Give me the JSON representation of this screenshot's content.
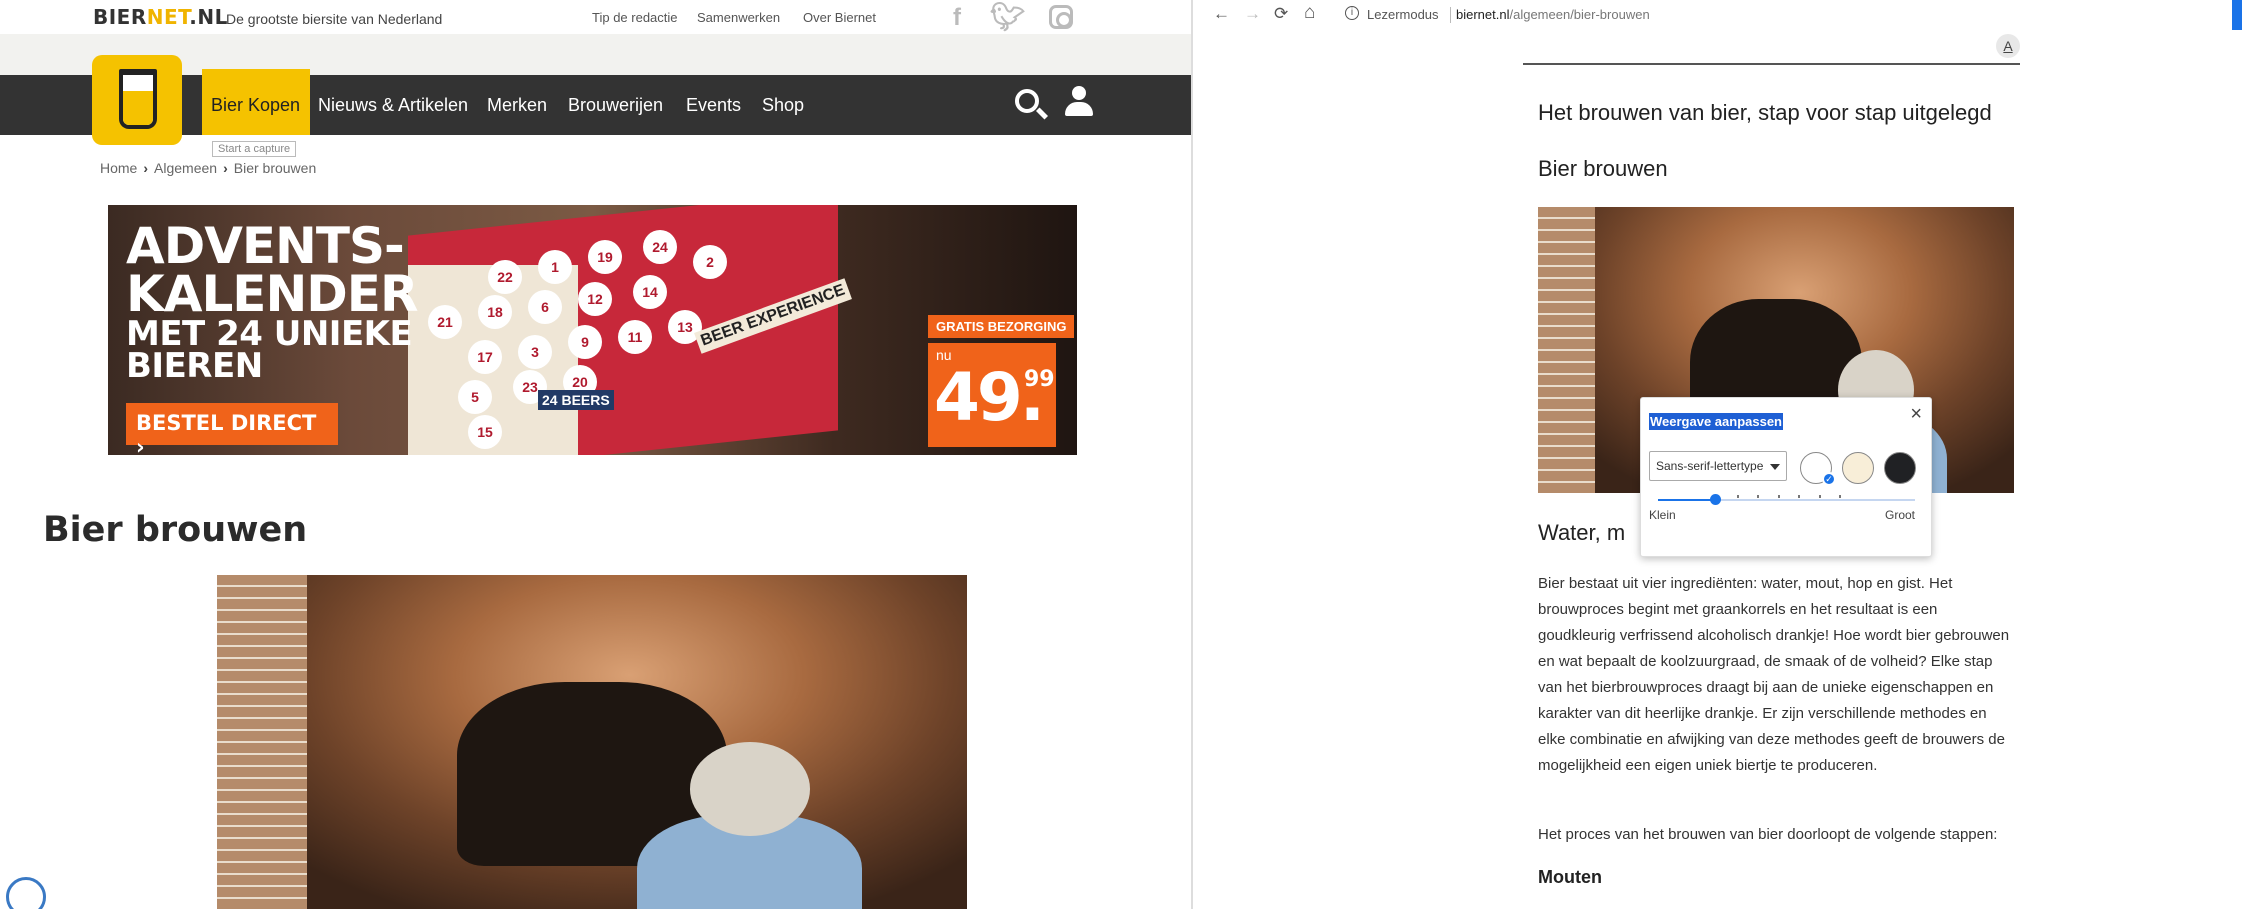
{
  "site": {
    "logo_pre": "BIER",
    "logo_net": "NET",
    "logo_post": ".NL",
    "tagline": "De grootste biersite van Nederland",
    "top_links": [
      "Tip de redactie",
      "Samenwerken",
      "Over Biernet"
    ],
    "social_icons": [
      "facebook-icon",
      "twitter-icon",
      "instagram-icon"
    ],
    "nav": [
      {
        "label": "Bier Kopen",
        "active": true
      },
      {
        "label": "Nieuws & Artikelen"
      },
      {
        "label": "Merken"
      },
      {
        "label": "Brouwerijen"
      },
      {
        "label": "Events"
      },
      {
        "label": "Shop"
      }
    ],
    "tooltip": "Start a capture",
    "breadcrumb": [
      "Home",
      "Algemeen",
      "Bier brouwen"
    ],
    "banner": {
      "line1": "ADVENTS-",
      "line2": "KALENDER",
      "line3": "MET 24 UNIEKE",
      "line4": "BIEREN",
      "cta": "BESTEL DIRECT ›",
      "box_label_1": "BEER EXPERIENCE",
      "box_label_2": "24 BEERS",
      "door_numbers": [
        "22",
        "1",
        "19",
        "24",
        "2",
        "21",
        "18",
        "6",
        "12",
        "14",
        "17",
        "3",
        "9",
        "11",
        "13",
        "5",
        "23",
        "20",
        "15"
      ],
      "shipping": "GRATIS BEZORGING",
      "price_prefix": "nu",
      "price_main": "49.",
      "price_cents": "99"
    },
    "page_title": "Bier brouwen"
  },
  "browser": {
    "back_icon": "←",
    "forward_icon": "→",
    "reload_icon": "⟳",
    "home_icon": "⌂",
    "mode_label": "Lezermodus",
    "url_host": "biernet.nl",
    "url_path": "/algemeen/bier-brouwen",
    "font_button": "A"
  },
  "reader": {
    "title": "Het brouwen van bier, stap voor stap uitgelegd",
    "heading": "Bier brouwen",
    "section_heading": "Water, m",
    "paragraph1": "Bier bestaat uit vier ingrediënten: water, mout, hop en gist. Het brouwproces begint met graankorrels en het resultaat is een goudkleurig verfrissend alcoholisch drankje! Hoe wordt bier gebrouwen en wat bepaalt de koolzuurgraad, de smaak of de volheid? Elke stap van het bierbrouwproces draagt bij aan de unieke eigenschappen en karakter van dit heerlijke drankje. Er zijn verschillende methodes en elke combinatie en afwijking van deze methodes geeft de brouwers de mogelijkheid een eigen uniek biertje te produceren.",
    "paragraph2": "Het proces van het brouwen van bier doorloopt de volgende stappen:",
    "subheading": "Mouten"
  },
  "popup": {
    "title": "Weergave aanpassen",
    "close": "×",
    "font_select": "Sans-serif-lettertype",
    "themes": [
      {
        "name": "light",
        "color": "#ffffff",
        "selected": true
      },
      {
        "name": "sepia",
        "color": "#f8eed8"
      },
      {
        "name": "dark",
        "color": "#202124"
      }
    ],
    "size_min_label": "Klein",
    "size_max_label": "Groot",
    "size_level": 0.22
  },
  "colors": {
    "brand_yellow": "#f5c200",
    "nav_bg": "#333333",
    "promo_orange": "#f0631a",
    "chrome_blue": "#1a73e8"
  }
}
